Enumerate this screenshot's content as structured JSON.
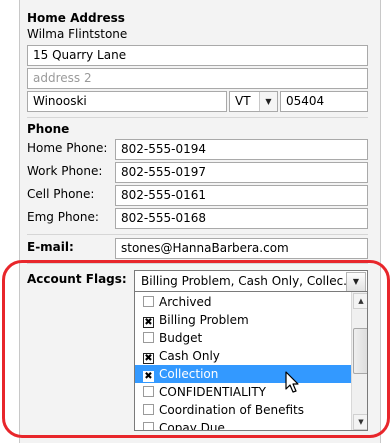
{
  "home_address": {
    "heading": "Home Address",
    "name": "Wilma Flintstone",
    "address1": "15 Quarry Lane",
    "address2_placeholder": "address 2",
    "city": "Winooski",
    "state": "VT",
    "zip": "05404"
  },
  "phone": {
    "heading": "Phone",
    "rows": [
      {
        "label": "Home Phone:",
        "value": "802-555-0194"
      },
      {
        "label": "Work Phone:",
        "value": "802-555-0197"
      },
      {
        "label": "Cell Phone:",
        "value": "802-555-0161"
      },
      {
        "label": "Emg Phone:",
        "value": "802-555-0168"
      }
    ]
  },
  "email": {
    "label": "E-mail:",
    "value": "stones@HannaBarbera.com"
  },
  "account_flags": {
    "label": "Account Flags:",
    "selected_summary": "Billing Problem, Cash Only, Collec...",
    "options": [
      {
        "label": "Archived",
        "checked": false
      },
      {
        "label": "Billing Problem",
        "checked": true
      },
      {
        "label": "Budget",
        "checked": false
      },
      {
        "label": "Cash Only",
        "checked": true
      },
      {
        "label": "Collection",
        "checked": true,
        "highlighted": true
      },
      {
        "label": "CONFIDENTIALITY",
        "checked": false
      },
      {
        "label": "Coordination of Benefits",
        "checked": false
      },
      {
        "label": "Copay Due",
        "checked": false
      }
    ]
  },
  "icons": {
    "dropdown_arrow": "chevron-down-icon",
    "scroll_up": "scroll-up-icon",
    "scroll_down": "scroll-down-icon",
    "cursor": "mouse-pointer-icon",
    "check_mark": "✖"
  },
  "colors": {
    "highlight_ring": "#e8262b",
    "selection": "#3399ff"
  }
}
